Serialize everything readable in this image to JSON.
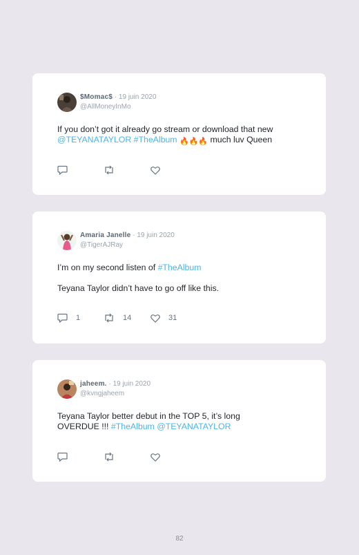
{
  "tweets": [
    {
      "name": "$Momac$",
      "date": "19 juin 2020",
      "handle": "@AllMoneyInMo",
      "line1": "If you don’t got it already go stream or download that new",
      "line2_link1": "@TEYANATAYLOR",
      "line2_link2": "#TheAlbum",
      "line2_emoji": "🔥🔥🔥",
      "line2_rest": "much luv Queen",
      "replies": "",
      "retweets": "",
      "likes": ""
    },
    {
      "name": "Amaria Janelle",
      "date": "19 juin 2020",
      "handle": "@TigerAJRay",
      "line1_text": "I’m on my second listen of ",
      "line1_link": "#TheAlbum",
      "line2": "Teyana Taylor didn’t have to go off like this.",
      "replies": "1",
      "retweets": "14",
      "likes": "31"
    },
    {
      "name": "jaheem.",
      "date": "19 juin 2020",
      "handle": "@kvngjaheem",
      "line1": "Teyana Taylor better debut in the TOP 5, it’s long",
      "line2_text": "OVERDUE !!! ",
      "line2_link1": "#TheAlbum",
      "line2_link2": "@TEYANATAYLOR",
      "replies": "",
      "retweets": "",
      "likes": ""
    }
  ],
  "separator": "·",
  "page_number": "82",
  "colors": {
    "background": "#e9e6ee",
    "card": "#ffffff",
    "link": "#4db3e6",
    "muted": "#9aa3ad"
  }
}
